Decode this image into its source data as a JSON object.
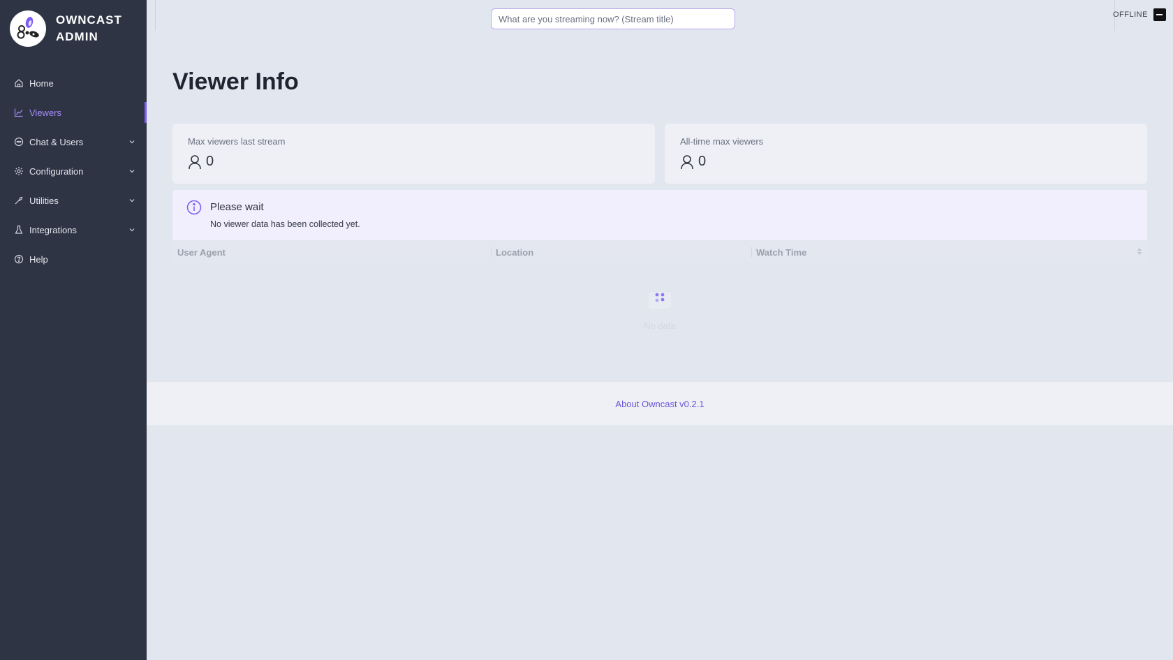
{
  "brand": {
    "title": "OWNCAST\nADMIN"
  },
  "sidebar": {
    "items": [
      {
        "label": "Home",
        "icon": "home-icon"
      },
      {
        "label": "Viewers",
        "icon": "line-chart-icon",
        "active": true
      },
      {
        "label": "Chat & Users",
        "icon": "chat-icon",
        "expandable": true
      },
      {
        "label": "Configuration",
        "icon": "gear-icon",
        "expandable": true
      },
      {
        "label": "Utilities",
        "icon": "tool-icon",
        "expandable": true
      },
      {
        "label": "Integrations",
        "icon": "flask-icon",
        "expandable": true
      },
      {
        "label": "Help",
        "icon": "question-icon"
      }
    ]
  },
  "header": {
    "stream_title_placeholder": "What are you streaming now? (Stream title)",
    "status": "OFFLINE"
  },
  "main": {
    "title": "Viewer Info",
    "stats": [
      {
        "label": "Max viewers last stream",
        "value": "0"
      },
      {
        "label": "All-time max viewers",
        "value": "0"
      }
    ],
    "alert": {
      "title": "Please wait",
      "description": "No viewer data has been collected yet."
    },
    "table": {
      "columns": [
        "User Agent",
        "Location",
        "Watch Time"
      ],
      "empty_text": "No data"
    }
  },
  "footer": {
    "link": "About Owncast v0.2.1"
  },
  "colors": {
    "accent": "#7c5cf5",
    "sidebar_bg": "#2e3444",
    "page_bg": "#e2e6ef"
  }
}
